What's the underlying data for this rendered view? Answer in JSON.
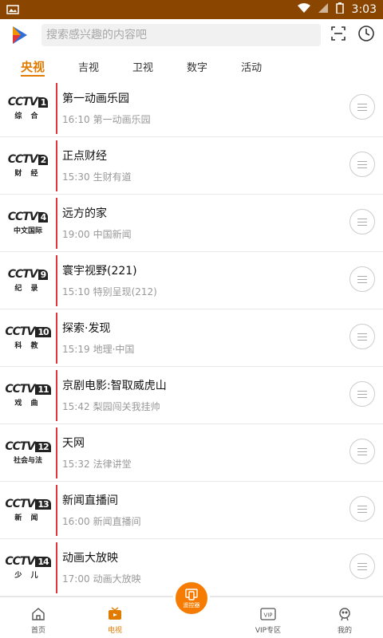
{
  "status": {
    "time": "3:03"
  },
  "search": {
    "placeholder": "搜索感兴趣的内容吧"
  },
  "tabs": [
    {
      "label": "央视",
      "active": true
    },
    {
      "label": "吉视"
    },
    {
      "label": "卫视"
    },
    {
      "label": "数字"
    },
    {
      "label": "活动"
    }
  ],
  "channels": [
    {
      "num": "1",
      "sub": "综 合",
      "title": "第一动画乐园",
      "time": "16:10",
      "next": "第一动画乐园"
    },
    {
      "num": "2",
      "sub": "财 经",
      "title": "正点财经",
      "time": "15:30",
      "next": "生财有道"
    },
    {
      "num": "4",
      "sub": "中文国际",
      "title": "远方的家",
      "time": "19:00",
      "next": "中国新闻"
    },
    {
      "num": "9",
      "sub": "纪 录",
      "title": "寰宇视野(221)",
      "time": "15:10",
      "next": "特别呈现(212)"
    },
    {
      "num": "10",
      "sub": "科 教",
      "title": "探索·发现",
      "time": "15:19",
      "next": "地理·中国"
    },
    {
      "num": "11",
      "sub": "戏 曲",
      "title": "京剧电影:智取威虎山",
      "time": "15:42",
      "next": "梨园闯关我挂帅"
    },
    {
      "num": "12",
      "sub": "社会与法",
      "title": "天网",
      "time": "15:32",
      "next": "法律讲堂"
    },
    {
      "num": "13",
      "sub": "新 闻",
      "title": "新闻直播间",
      "time": "16:00",
      "next": "新闻直播间"
    },
    {
      "num": "14",
      "sub": "少 儿",
      "title": "动画大放映",
      "time": "17:00",
      "next": "动画大放映"
    }
  ],
  "nav": {
    "home": "首页",
    "tv": "电视",
    "remote": "遥控器",
    "vip": "VIP专区",
    "vip_badge": "VIP",
    "mine": "我的"
  },
  "colors": {
    "accent": "#e07b00",
    "statusbar": "#8a4500",
    "divider_red": "#e2363b"
  }
}
